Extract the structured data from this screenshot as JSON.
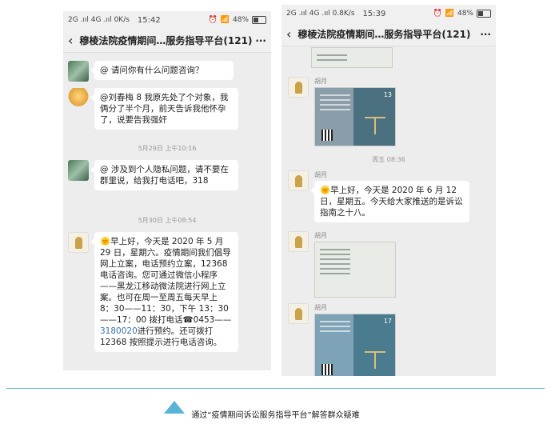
{
  "left": {
    "status": {
      "signal": "2G .ııl 4G .ııl 0K/s",
      "time": "15:42",
      "battery": "48%"
    },
    "title": "穆棱法院疫情期间…服务指导平台(121)",
    "messages": [
      {
        "text": "@ 请问你有什么问题咨询？"
      },
      {
        "text": "@刘春梅 8 我原先处了个对象，我俩分了半个月，前天告诉我他怀孕了，说要告我强奸"
      },
      {
        "stamp": "5月29日 上午10:16"
      },
      {
        "text": "@ 涉及到个人隐私问题，请不要在群里说，给我打电话吧，318"
      },
      {
        "stamp": "5月30日 上午08:54"
      },
      {
        "text_before_phone": "🌞早上好，今天是 2020 年 5 月 29 日，星期六。疫情期间我们倡导网上立案，电话预约立案，12368 电话咨询。您可通过微信小程序——黑龙江移动微法院进行网上立案。也可在周一至周五每天早上 8：30——11：30，下午 13：30——17：00 拨打电话☎0453——",
        "phone": "3180020",
        "text_after_phone": "进行预约。还可拨打 12368 按照提示进行电话咨询。"
      }
    ]
  },
  "right": {
    "status": {
      "signal": "2G .ııl 4G .ııl 0.8K/s",
      "time": "15:39",
      "battery": "48%"
    },
    "title": "穆棱法院疫情期间…服务指导平台(121)",
    "sender": "胡月",
    "stamp": "周五 08:36",
    "message": "🌞早上好，今天是 2020 年 6 月 12 日，星期五。今天给大家推送的是诉讼指南之十八。",
    "doc_numbers": [
      "13",
      "17"
    ]
  },
  "caption": "通过“疫情期间诉讼服务指导平台”解答群众疑难",
  "colors": {
    "accent": "#5ab4d6",
    "chat_bg": "#ededed",
    "bubble": "#ffffff"
  }
}
